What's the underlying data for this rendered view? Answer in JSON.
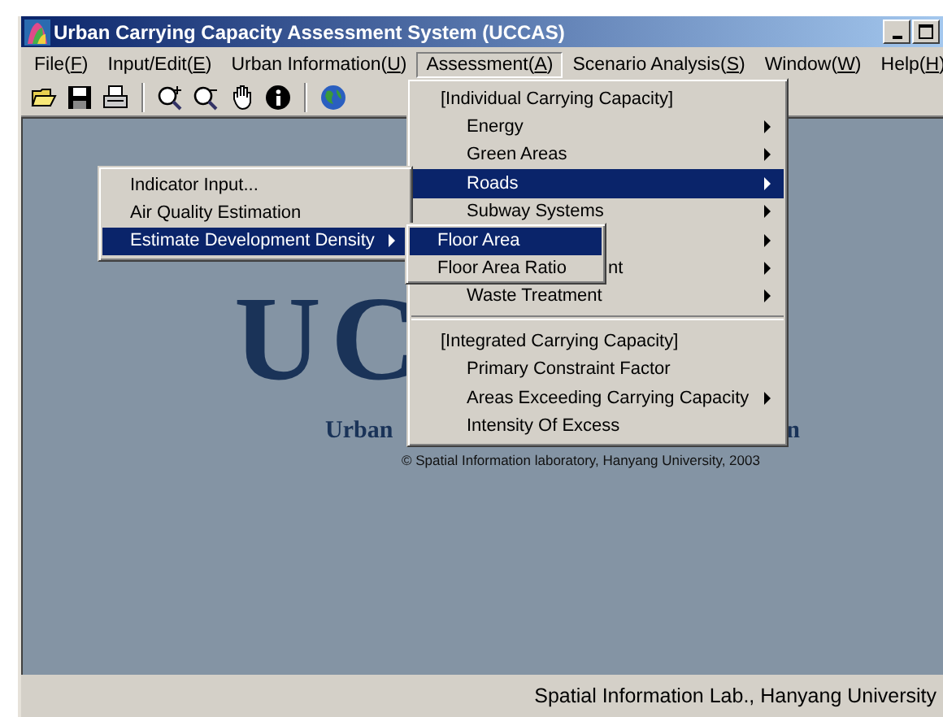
{
  "window": {
    "title": "Urban Carrying Capacity Assessment System (UCCAS)"
  },
  "menu_bar": [
    {
      "before": "File(",
      "key": "F",
      "after": ")",
      "selected": false
    },
    {
      "before": "Input/Edit(",
      "key": "E",
      "after": ")",
      "selected": false
    },
    {
      "before": "Urban Information(",
      "key": "U",
      "after": ")",
      "selected": false
    },
    {
      "before": "Assessment(",
      "key": "A",
      "after": ")",
      "selected": true
    },
    {
      "before": "Scenario Analysis(",
      "key": "S",
      "after": ")",
      "selected": false
    },
    {
      "before": "Window(",
      "key": "W",
      "after": ")",
      "selected": false
    },
    {
      "before": "Help(",
      "key": "H",
      "after": ")",
      "selected": false
    }
  ],
  "toolbar": [
    {
      "kind": "open"
    },
    {
      "kind": "save"
    },
    {
      "kind": "print"
    },
    {
      "kind": "separator"
    },
    {
      "kind": "zoom_in"
    },
    {
      "kind": "zoom_out"
    },
    {
      "kind": "pan"
    },
    {
      "kind": "info"
    },
    {
      "kind": "separator"
    },
    {
      "kind": "globe"
    }
  ],
  "assessment_menu": [
    {
      "kind": "header",
      "label": "[Individual Carrying Capacity]"
    },
    {
      "kind": "item",
      "label": "Energy",
      "submenu": true,
      "selected": false
    },
    {
      "kind": "item",
      "label": "Green Areas",
      "submenu": true,
      "selected": false
    },
    {
      "kind": "item",
      "label": "Roads",
      "submenu": true,
      "selected": true
    },
    {
      "kind": "item",
      "label": "Subway Systems",
      "submenu": true,
      "selected": false
    },
    {
      "kind": "covered",
      "submenu": true,
      "selected": false
    },
    {
      "kind": "covered",
      "label": "nt",
      "submenu": true,
      "selected": false
    },
    {
      "kind": "item",
      "label": "Waste Treatment",
      "submenu": true,
      "selected": false
    },
    {
      "kind": "separator"
    },
    {
      "kind": "header",
      "label": "[Integrated Carrying Capacity]"
    },
    {
      "kind": "item",
      "label": "Primary Constraint Factor",
      "submenu": false,
      "selected": false
    },
    {
      "kind": "item",
      "label": "Areas Exceeding Carrying Capacity",
      "submenu": true,
      "selected": false
    },
    {
      "kind": "item",
      "label": "Intensity Of Excess",
      "submenu": false,
      "selected": false
    }
  ],
  "popup_menu": [
    {
      "label": "Indicator Input...",
      "submenu": false,
      "selected": false
    },
    {
      "label": "Air Quality Estimation",
      "submenu": false,
      "selected": false
    },
    {
      "label": "Estimate Development Density",
      "submenu": true,
      "selected": true
    }
  ],
  "density_submenu": [
    {
      "label": "Floor Area",
      "selected": true
    },
    {
      "label": "Floor Area Ratio",
      "selected": false
    }
  ],
  "splash": {
    "letter_1": "U",
    "letter_2": "C",
    "subtitle_start": "Urban",
    "subtitle_end": "n",
    "copyright": "© Spatial Information laboratory, Hanyang University, 2003"
  },
  "status_bar": {
    "text": "Spatial Information Lab., Hanyang University"
  }
}
